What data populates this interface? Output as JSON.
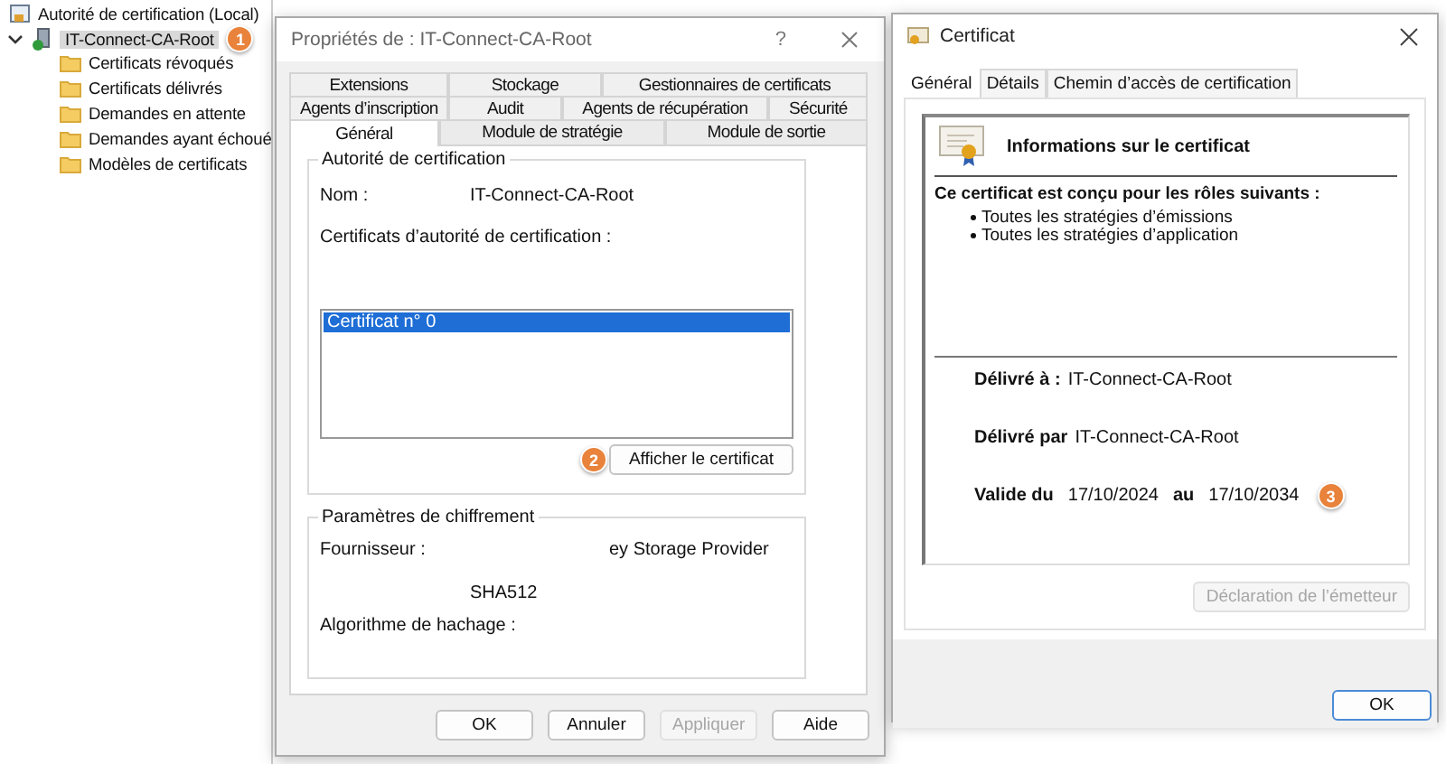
{
  "console": {
    "tree": {
      "label": "Autorité de certification (Local)",
      "ca": {
        "label": "IT-Connect-CA-Root",
        "selected": true,
        "expanded": true,
        "badge": "1",
        "children": [
          {
            "label": "Certificats révoqués",
            "selected": false
          },
          {
            "label": "Certificats délivrés",
            "selected": false
          },
          {
            "label": "Demandes en attente",
            "selected": false
          },
          {
            "label": "Demandes ayant échoué",
            "selected": false
          },
          {
            "label": "Modèles de certificats",
            "selected": false
          }
        ]
      }
    }
  },
  "properties_dialog": {
    "title": "Propriétés de : IT-Connect-CA-Root",
    "help": "?",
    "tab_rows": [
      [
        {
          "label": "Extensions",
          "selected": false
        },
        {
          "label": "Stockage",
          "selected": false
        },
        {
          "label": "Gestionnaires de certificats",
          "selected": false
        }
      ],
      [
        {
          "label": "Agents d’inscription",
          "selected": false
        },
        {
          "label": "Audit",
          "selected": false
        },
        {
          "label": "Agents de récupération",
          "selected": false
        },
        {
          "label": "Sécurité",
          "selected": false
        }
      ],
      [
        {
          "label": "Général",
          "selected": true
        },
        {
          "label": "Module de stratégie",
          "selected": false
        },
        {
          "label": "Module de sortie",
          "selected": false
        }
      ]
    ],
    "authority_group": {
      "legend": "Autorité de certification",
      "name_label": "Nom :",
      "name_value": "IT-Connect-CA-Root",
      "list_label": "Certificats d’autorité de certification :",
      "list_items": [
        {
          "label": "Certificat n° 0",
          "selected": true
        }
      ],
      "button": {
        "label": "Afficher le certificat",
        "badge": "2"
      }
    },
    "crypto_group": {
      "legend": "Paramètres de chiffrement",
      "provider_label": "Fournisseur :",
      "provider_value": "ey Storage Provider",
      "hash_value": "SHA512",
      "hash_label": "Algorithme de hachage :"
    },
    "buttons": [
      {
        "label": "OK",
        "disabled": false
      },
      {
        "label": "Annuler",
        "disabled": false
      },
      {
        "label": "Appliquer",
        "disabled": true
      },
      {
        "label": "Aide",
        "disabled": false
      }
    ]
  },
  "certificate_dialog": {
    "title": "Certificat",
    "tabs": [
      {
        "label": "Général",
        "selected": true
      },
      {
        "label": "Détails",
        "selected": false
      },
      {
        "label": "Chemin d’accès de certification",
        "selected": false
      }
    ],
    "heading": "Informations sur le certificat",
    "purpose_title": "Ce certificat est conçu pour les rôles suivants :",
    "purposes": [
      "Toutes les stratégies d’émissions",
      "Toutes les stratégies d’application"
    ],
    "issued_to_label": "Délivré à :",
    "issued_to": "IT-Connect-CA-Root",
    "issued_by_label": "Délivré par",
    "issued_by": "IT-Connect-CA-Root",
    "valid_from_label": "Valide du",
    "valid_from": "17/10/2024",
    "valid_to_label": "au",
    "valid_to": "17/10/2034",
    "badge": "3",
    "issuer_statement": {
      "label": "Déclaration de l’émetteur",
      "disabled": true
    },
    "ok": {
      "label": "OK",
      "disabled": false
    }
  }
}
